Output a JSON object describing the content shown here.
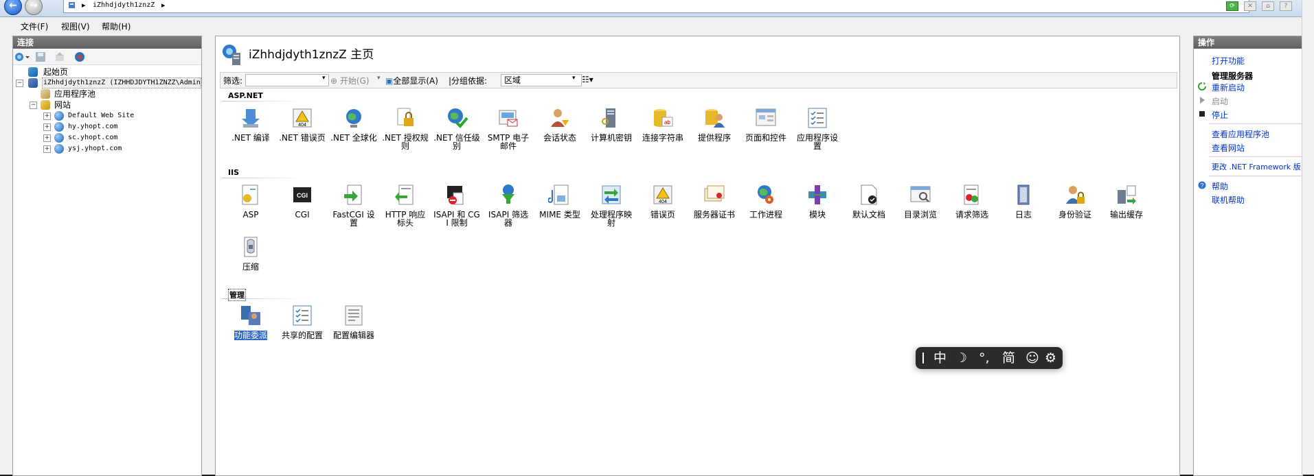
{
  "address": {
    "sep1": "▸",
    "server_name": "iZhhdjdyth1znzZ",
    "sep2": "▸"
  },
  "menu": {
    "file": "文件(F)",
    "view": "视图(V)",
    "help": "帮助(H)"
  },
  "connections": {
    "header": "连接",
    "tree": {
      "start_page": "起始页",
      "server": "iZhhdjdyth1znzZ (IZHHDJDYTH1ZNZZ\\Admini",
      "app_pools": "应用程序池",
      "sites": "网站",
      "site_list": [
        "Default Web Site",
        "hy.yhopt.com",
        "sc.yhopt.com",
        "ysj.yhopt.com"
      ]
    }
  },
  "main": {
    "title": "iZhhdjdyth1znzZ 主页",
    "filter": {
      "label": "筛选:",
      "start": "开始(G)",
      "show_all": "全部显示(A)",
      "group_label": "|分组依据:",
      "group_value": "区域"
    },
    "groups": {
      "aspnet": "ASP.NET",
      "iis": "IIS",
      "manage": "管理"
    },
    "aspnet_features": [
      ".NET 编译",
      ".NET 错误页",
      ".NET 全球化",
      ".NET 授权规则",
      ".NET 信任级别",
      "SMTP 电子邮件",
      "会话状态",
      "计算机密钥",
      "连接字符串",
      "提供程序",
      "页面和控件",
      "应用程序设置"
    ],
    "iis_features": [
      "ASP",
      "CGI",
      "FastCGI 设置",
      "HTTP 响应标头",
      "ISAPI 和 CGI 限制",
      "ISAPI 筛选器",
      "MIME 类型",
      "处理程序映射",
      "错误页",
      "服务器证书",
      "工作进程",
      "模块",
      "默认文档",
      "目录浏览",
      "请求筛选",
      "日志",
      "身份验证",
      "输出缓存",
      "压缩"
    ],
    "manage_features": [
      "功能委派",
      "共享的配置",
      "配置编辑器"
    ],
    "icon_texts": {
      "err404": "404",
      "cgi": "CGI",
      "ab": "ab"
    }
  },
  "actions": {
    "header": "操作",
    "open_feature": "打开功能",
    "manage_server": "管理服务器",
    "restart": "重新启动",
    "start": "启动",
    "stop": "停止",
    "view_app_pools": "查看应用程序池",
    "view_sites": "查看网站",
    "change_framework": "更改 .NET Framework 版",
    "help": "帮助",
    "online_help": "联机帮助"
  },
  "ime": {
    "lang": "中",
    "moon": "☽",
    "punct": "°,",
    "simp": "简",
    "emoji": "☺",
    "gear": "⚙"
  },
  "colors": {
    "accent": "#316ac5",
    "link": "#0033cc",
    "panel_header": "#6e6e6e"
  }
}
